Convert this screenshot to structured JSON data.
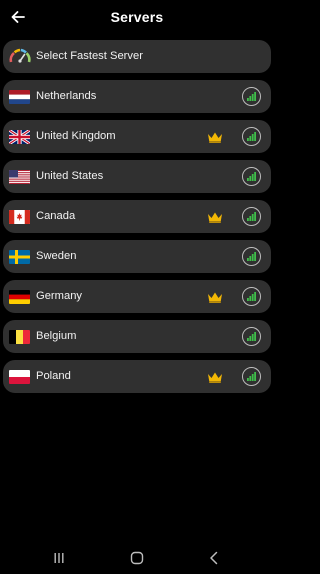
{
  "header": {
    "title": "Servers",
    "back_icon": "arrow-left-icon"
  },
  "servers": [
    {
      "label": "Select Fastest Server",
      "icon": "speedometer-icon",
      "premium": false
    },
    {
      "label": "Netherlands",
      "flag": "netherlands-flag-icon",
      "premium": false
    },
    {
      "label": "United Kingdom",
      "flag": "uk-flag-icon",
      "premium": true
    },
    {
      "label": "United States",
      "flag": "us-flag-icon",
      "premium": false
    },
    {
      "label": "Canada",
      "flag": "canada-flag-icon",
      "premium": true
    },
    {
      "label": "Sweden",
      "flag": "sweden-flag-icon",
      "premium": false
    },
    {
      "label": "Germany",
      "flag": "germany-flag-icon",
      "premium": true
    },
    {
      "label": "Belgium",
      "flag": "belgium-flag-icon",
      "premium": false
    },
    {
      "label": "Poland",
      "flag": "poland-flag-icon",
      "premium": true
    }
  ],
  "colors": {
    "background": "#000000",
    "row": "#303030",
    "signal_green": "#3fbf4a",
    "crown_gold": "#f2b705"
  },
  "navbar": {
    "recents_icon": "recents-icon",
    "home_icon": "home-icon",
    "back_icon": "back-triangle-icon"
  }
}
